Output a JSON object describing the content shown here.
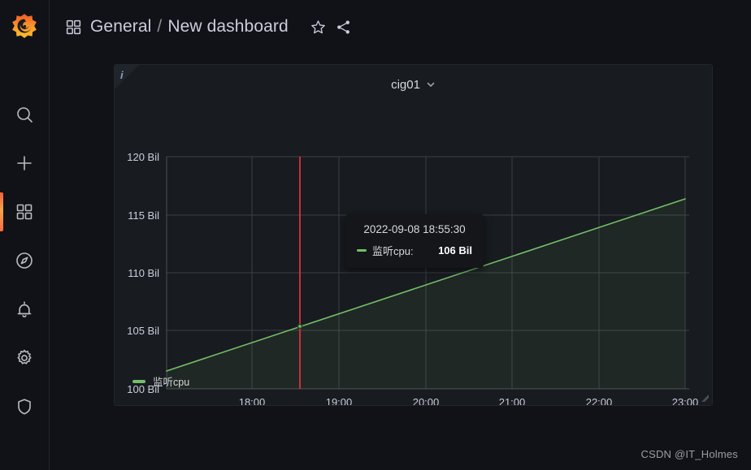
{
  "sidebar": {
    "logo_name": "grafana-logo",
    "items": [
      {
        "name": "search-icon",
        "label": "Search"
      },
      {
        "name": "plus-icon",
        "label": "Create"
      },
      {
        "name": "dashboards-icon",
        "label": "Dashboards"
      },
      {
        "name": "compass-icon",
        "label": "Explore"
      },
      {
        "name": "bell-icon",
        "label": "Alerting"
      },
      {
        "name": "gear-icon",
        "label": "Configuration"
      },
      {
        "name": "shield-icon",
        "label": "Server Admin"
      }
    ],
    "active_index": 2,
    "active_indicator_color": "#f55f3e"
  },
  "header": {
    "grid_icon": "dashboards-grid-icon",
    "folder": "General",
    "separator": "/",
    "title": "New dashboard",
    "star_icon": "star-icon",
    "share_icon": "share-icon"
  },
  "panel": {
    "info_icon": "info-icon",
    "title": "cig01",
    "menu_icon": "chevron-down-icon",
    "background": "#181b1f"
  },
  "tooltip": {
    "time": "2022-09-08 18:55:30",
    "series": "监听cpu:",
    "value": "106 Bil",
    "color": "#73bf69"
  },
  "legend": {
    "series": "监听cpu",
    "color": "#73bf69"
  },
  "watermark": "CSDN @IT_Holmes",
  "chart_data": {
    "type": "area",
    "title": "cig01",
    "xlabel": "",
    "ylabel": "",
    "grid": true,
    "legend_position": "bottom-left",
    "series": [
      {
        "name": "监听cpu",
        "color": "#73bf69",
        "fill_color": "rgba(115,191,105,0.10)",
        "x": [
          "17:30",
          "18:00",
          "18:55:30",
          "19:00",
          "20:00",
          "21:00",
          "22:00",
          "23:00"
        ],
        "values": [
          101.5,
          103.0,
          106.0,
          106.2,
          108.8,
          111.4,
          114.0,
          116.5
        ]
      }
    ],
    "x_ticks": [
      "18:00",
      "19:00",
      "20:00",
      "21:00",
      "22:00",
      "23:00"
    ],
    "y_ticks": [
      "100 Bil",
      "105 Bil",
      "110 Bil",
      "115 Bil",
      "120 Bil"
    ],
    "ylim": [
      100,
      120
    ],
    "unit": "Bil",
    "cursor": {
      "x_label": "18:55:30",
      "color": "#e02f44",
      "point_value": "106 Bil"
    }
  }
}
